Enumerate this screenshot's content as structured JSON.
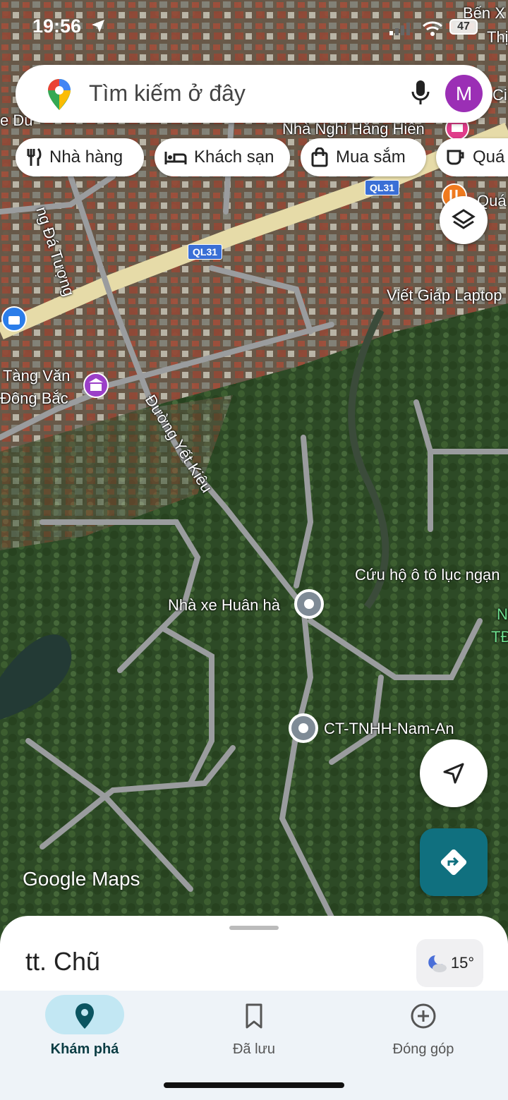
{
  "status": {
    "time": "19:56",
    "battery": "47"
  },
  "search": {
    "placeholder": "Tìm kiếm ở đây",
    "avatar_letter": "M"
  },
  "chips": [
    {
      "label": "Nhà hàng",
      "icon": "restaurant-icon"
    },
    {
      "label": "Khách sạn",
      "icon": "hotel-icon"
    },
    {
      "label": "Mua sắm",
      "icon": "shopping-bag-icon"
    },
    {
      "label": "Quá",
      "icon": "coffee-icon"
    }
  ],
  "map": {
    "labels": {
      "ben": "Bến X",
      "thi": "Thị",
      "ci": "Ci",
      "du": "e Dư",
      "nha_nghi": "Nhà Nghỉ Hằng Hiền",
      "qua": "Quá",
      "da_tuong": "ng Đá Tượng",
      "viet_giap": "Viết Giáp Laptop",
      "tang_van": "Tàng Văn",
      "dong_bac": "Đông Bắc",
      "yet_kieu": "Đường Yết Kiêu",
      "cuu_ho": "Cứu hộ ô tô lục ngạn",
      "n": "N",
      "td": "TĐ",
      "nha_xe": "Nhà xe Huân hà",
      "ct": "CT-TNHH-Nam-An"
    },
    "road_shields": [
      "QL31",
      "QL31"
    ],
    "logo": "Google Maps"
  },
  "sheet": {
    "place": "tt. Chũ",
    "temperature": "15°"
  },
  "nav": [
    {
      "label": "Khám phá",
      "active": true
    },
    {
      "label": "Đã lưu",
      "active": false
    },
    {
      "label": "Đóng góp",
      "active": false
    }
  ],
  "colors": {
    "accent": "#0b6e7f",
    "active_pill": "#c2e7f3",
    "avatar": "#9b2fb5",
    "direction_button": "#10707f"
  }
}
